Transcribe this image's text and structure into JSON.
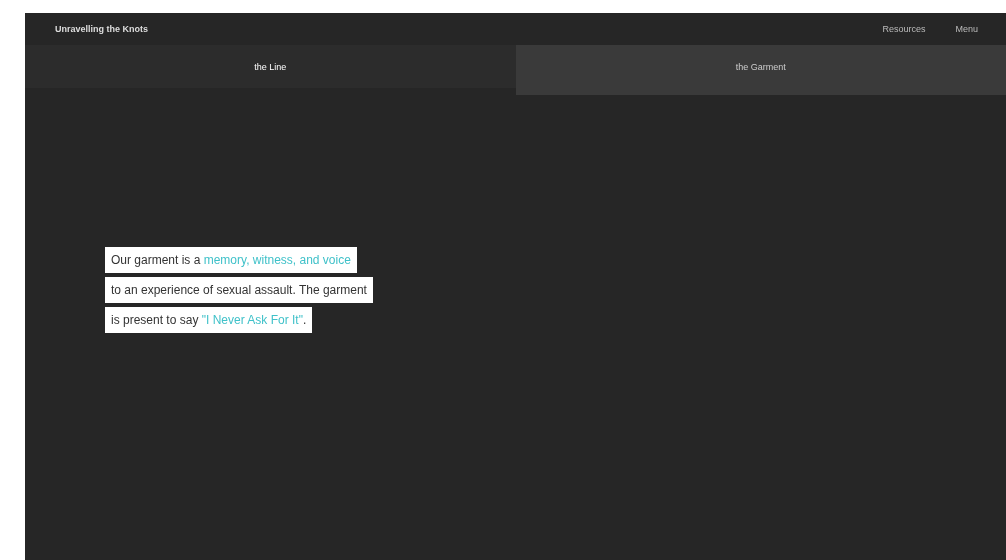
{
  "header": {
    "title": "Unravelling the Knots",
    "links": [
      "Resources",
      "Menu"
    ]
  },
  "tabs": [
    {
      "label": "the Line",
      "selected": true
    },
    {
      "label": "the Garment",
      "selected": false
    }
  ],
  "statement": {
    "lines": [
      [
        {
          "kind": "plain",
          "text": "Our garment is a "
        },
        {
          "kind": "highlight",
          "text": "memory, witness, and voice"
        }
      ],
      [
        {
          "kind": "plain",
          "text": "to an experience of sexual assault. The garment"
        }
      ],
      [
        {
          "kind": "plain",
          "text": "is present to say "
        },
        {
          "kind": "highlight",
          "text": "\"I Never Ask For It\""
        },
        {
          "kind": "plain",
          "text": "."
        }
      ]
    ]
  }
}
